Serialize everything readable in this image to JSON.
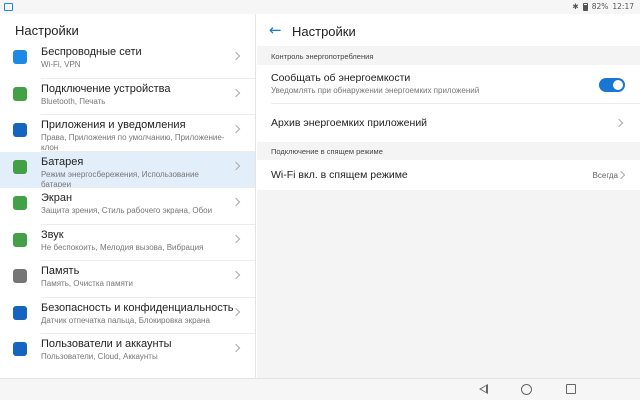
{
  "status_bar": {
    "battery": "82%",
    "time": "12:17"
  },
  "left_panel": {
    "title": "Настройки",
    "items": [
      {
        "title": "Беспроводные сети",
        "subtitle": "Wi-Fi, VPN",
        "icon": "wifi-icon",
        "color": "#1e88e5"
      },
      {
        "title": "Подключение устройства",
        "subtitle": "Bluetooth, Печать",
        "icon": "device-connection-icon",
        "color": "#43a047"
      },
      {
        "title": "Приложения и уведомления",
        "subtitle": "Права, Приложения по умолчанию, Приложение-клон",
        "icon": "apps-icon",
        "color": "#1565c0"
      },
      {
        "title": "Батарея",
        "subtitle": "Режим энергосбережения, Использование батареи",
        "icon": "battery-icon",
        "color": "#43a047"
      },
      {
        "title": "Экран",
        "subtitle": "Защита зрения, Стиль рабочего экрана, Обои",
        "icon": "display-icon",
        "color": "#43a047"
      },
      {
        "title": "Звук",
        "subtitle": "Не беспокоить, Мелодия вызова, Вибрация",
        "icon": "sound-icon",
        "color": "#43a047"
      },
      {
        "title": "Память",
        "subtitle": "Память, Очистка памяти",
        "icon": "storage-icon",
        "color": "#757575"
      },
      {
        "title": "Безопасность и конфиденциальность",
        "subtitle": "Датчик отпечатка пальца, Блокировка экрана",
        "icon": "shield-icon",
        "color": "#1565c0"
      },
      {
        "title": "Пользователи и аккаунты",
        "subtitle": "Пользователи, Cloud, Аккаунты",
        "icon": "user-icon",
        "color": "#1565c0"
      }
    ],
    "selected_index": 3
  },
  "right_panel": {
    "title": "Настройки",
    "section1": "Контроль энергопотребления",
    "notify_title": "Сообщать об энергоемкости",
    "notify_subtitle": "Уведомлять при обнаружении энергоемких приложений",
    "notify_enabled": true,
    "archive": "Архив энергоемких приложений",
    "section2": "Подключение в спящем режиме",
    "wifi_sleep": "Wi-Fi вкл. в спящем режиме",
    "wifi_sleep_value": "Всегда"
  },
  "colors": {
    "accent": "#1976d2",
    "selected_bg": "#e3eefb"
  }
}
